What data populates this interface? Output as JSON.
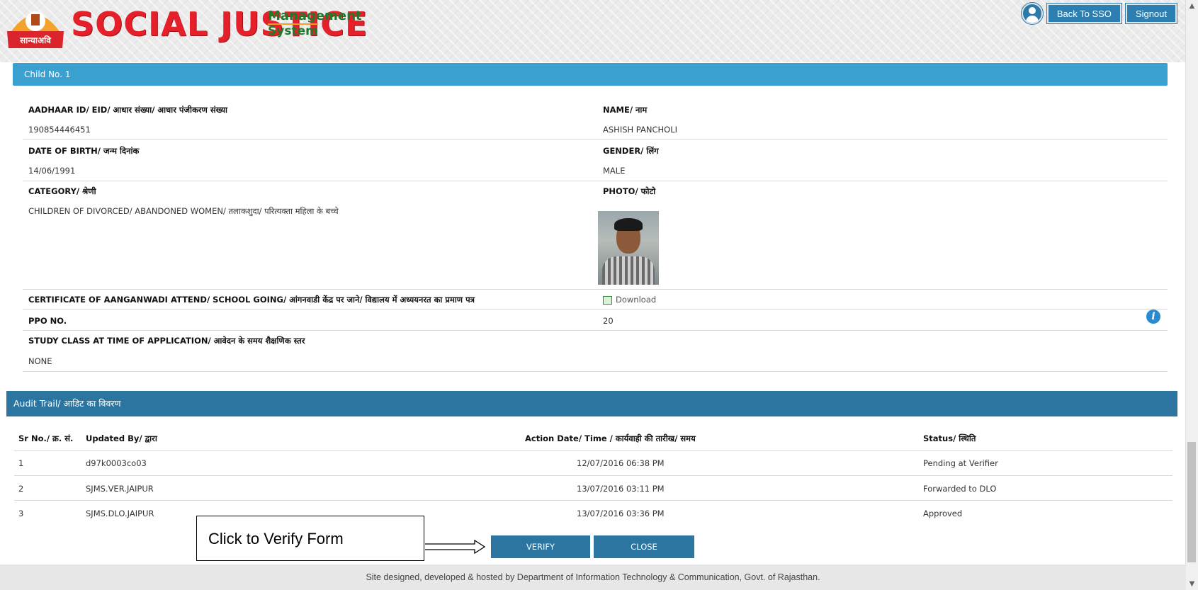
{
  "header": {
    "emblem_text": "सान्याअवि",
    "logo_title": "SOCIAL JUSTICE",
    "logo_management": "Management",
    "logo_system": "System",
    "back_label": "Back To SSO",
    "signout_label": "Signout"
  },
  "child": {
    "section_title": "Child No. 1",
    "fields": {
      "aadhaar_label": "AADHAAR ID/ EID/ आधार संख्या/ आधार पंजीकरण संख्या",
      "aadhaar_value": "190854446451",
      "name_label": "NAME/ नाम",
      "name_value": "ASHISH PANCHOLI",
      "dob_label": "DATE OF BIRTH/ जन्म दिनांक",
      "dob_value": "14/06/1991",
      "gender_label": "GENDER/ लिंग",
      "gender_value": "MALE",
      "category_label": "CATEGORY/ श्रेणी",
      "category_value": "CHILDREN OF DIVORCED/ ABANDONED WOMEN/ तलाकशुदा/ परित्यक्ता महिला के बच्चे",
      "photo_label": "PHOTO/ फोटो",
      "certificate_label": "CERTIFICATE OF AANGANWADI ATTEND/ SCHOOL GOING/ आंगनवाडी केंद्र पर जाने/ विद्यालय में अध्ययनरत का प्रमाण पत्र",
      "download_label": "Download",
      "ppo_label": "PPO NO.",
      "ppo_value": "20",
      "study_label": "STUDY CLASS AT TIME OF APPLICATION/ आवेदन के समय शैक्षणिक स्तर",
      "study_value": "NONE"
    }
  },
  "audit": {
    "title": "Audit Trail/ आडिट का विवरण",
    "columns": [
      "Sr No./ क्र. सं.",
      "Updated By/ द्वारा",
      "Action Date/ Time / कार्यवाही की तारीख/ समय",
      "Status/ स्थिति"
    ],
    "rows": [
      [
        "1",
        "d97k0003co03",
        "12/07/2016 06:38 PM",
        "Pending at Verifier"
      ],
      [
        "2",
        "SJMS.VER.JAIPUR",
        "13/07/2016 03:11 PM",
        "Forwarded to DLO"
      ],
      [
        "3",
        "SJMS.DLO.JAIPUR",
        "13/07/2016 03:36 PM",
        "Approved"
      ]
    ]
  },
  "actions": {
    "verify_label": "VERIFY",
    "close_label": "CLOSE"
  },
  "callout": {
    "text": "Click to Verify Form"
  },
  "footer": {
    "text": "Site designed, developed & hosted by Department of Information Technology & Communication, Govt. of Rajasthan."
  },
  "colors": {
    "child_bar": "#3aa0d0",
    "audit_bar": "#2c75a0",
    "button": "#2c75a0",
    "logo_red": "#e5202a",
    "logo_green": "#1f7a2a"
  },
  "icons": [
    "emblem-icon",
    "user-icon",
    "download-icon",
    "info-icon",
    "arrow-icon"
  ]
}
